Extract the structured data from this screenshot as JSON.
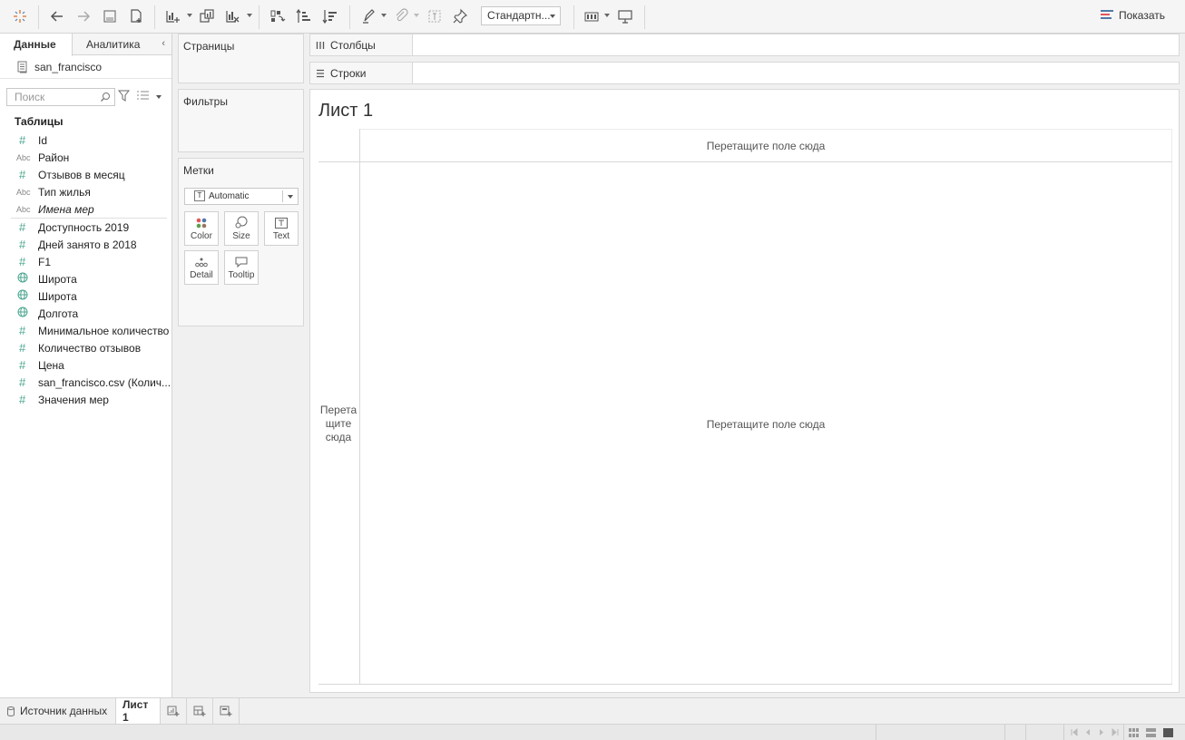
{
  "toolbar": {
    "fit_select": "Стандартн...",
    "show_me": "Показать",
    "colors": {
      "icon": "#555555",
      "show_me_accent": "#4e79a7"
    }
  },
  "left_pane": {
    "tabs": [
      {
        "label": "Данные",
        "active": true
      },
      {
        "label": "Аналитика",
        "active": false
      }
    ],
    "datasource": "san_francisco",
    "search_placeholder": "Поиск",
    "tables_title": "Таблицы",
    "dimensions": [
      {
        "type": "hash",
        "label": "Id"
      },
      {
        "type": "abc",
        "label": "Район"
      },
      {
        "type": "hash",
        "label": "Отзывов в месяц"
      },
      {
        "type": "abc",
        "label": "Тип жилья"
      },
      {
        "type": "abc",
        "label": "Имена мер",
        "italic": true
      }
    ],
    "measures": [
      {
        "type": "hash",
        "label": "Доступность 2019"
      },
      {
        "type": "hash",
        "label": "Дней занято в 2018"
      },
      {
        "type": "hash",
        "label": "F1"
      },
      {
        "type": "globe",
        "label": "Широта"
      },
      {
        "type": "globe",
        "label": "Широта"
      },
      {
        "type": "globe",
        "label": "Долгота"
      },
      {
        "type": "hash",
        "label": "Минимальное количество"
      },
      {
        "type": "hash",
        "label": "Количество отзывов"
      },
      {
        "type": "hash",
        "label": "Цена"
      },
      {
        "type": "hash",
        "label": "san_francisco.csv (Колич..."
      },
      {
        "type": "hash",
        "label": "Значения мер"
      }
    ],
    "abc_icon_text": "Abc",
    "hash_icon_text": "#"
  },
  "cards": {
    "pages": "Страницы",
    "filters": "Фильтры",
    "marks": "Метки",
    "marks_type": "Automatic",
    "marks_type_icon": "T",
    "mark_buttons": {
      "color": "Color",
      "size": "Size",
      "text": "Text",
      "detail": "Detail",
      "tooltip": "Tooltip"
    }
  },
  "shelves": {
    "columns": "Столбцы",
    "rows": "Строки"
  },
  "sheet": {
    "title": "Лист 1",
    "drop_columns": "Перетащите поле сюда",
    "drop_rows": "Перета щите сюда",
    "drop_center": "Перетащите поле сюда"
  },
  "sheet_bar": {
    "datasource_tab": "Источник данных",
    "active_sheet": "Лист 1"
  }
}
